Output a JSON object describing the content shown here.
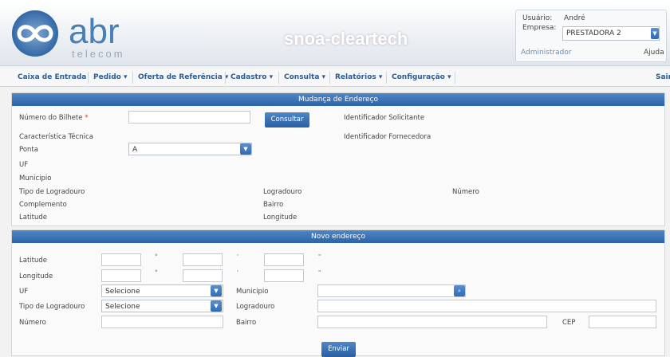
{
  "header": {
    "brand": "abr",
    "brand_sub": "telecom",
    "app_title": "snoa-cleartech",
    "user_label": "Usuário:",
    "user_value": "André",
    "company_label": "Empresa:",
    "company_value": "PRESTADORA 2",
    "role": "Administrador",
    "help": "Ajuda"
  },
  "menu": {
    "items": [
      {
        "label": "Caixa de Entrada"
      },
      {
        "label": "Pedido ▾"
      },
      {
        "label": "Oferta de Referência ▾"
      },
      {
        "label": "Cadastro ▾"
      },
      {
        "label": "Consulta ▾"
      },
      {
        "label": "Relatórios ▾"
      },
      {
        "label": "Configuração ▾"
      }
    ],
    "logout": "Sair"
  },
  "section1": {
    "title": "Mudança de Endereço",
    "ticket_label": "Número do Bilhete",
    "required_mark": "*",
    "ticket_value": "",
    "consult_button": "Consultar",
    "requester_label": "Identificador Solicitante",
    "tech_label": "Característica Técnica",
    "supplier_label": "Identificador Fornecedora",
    "point_label": "Ponta",
    "point_value": "A",
    "uf_label": "UF",
    "city_label": "Municipio",
    "street_type_label": "Tipo de Logradouro",
    "street_label": "Logradouro",
    "number_label": "Número",
    "complement_label": "Complemento",
    "district_label": "Bairro",
    "latitude_label": "Latitude",
    "longitude_label": "Longitude"
  },
  "section2": {
    "title": "Novo endereço",
    "latitude_label": "Latitude",
    "longitude_label": "Longitude",
    "deg": "°",
    "min": "'",
    "sec": "\"",
    "uf_label": "UF",
    "uf_value": "Selecione",
    "city_label": "Municipio",
    "street_type_label": "Tipo de Logradouro",
    "street_type_value": "Selecione",
    "street_label": "Logradouro",
    "number_label": "Número",
    "district_label": "Bairro",
    "cep_label": "CEP",
    "send_button": "Enviar"
  }
}
